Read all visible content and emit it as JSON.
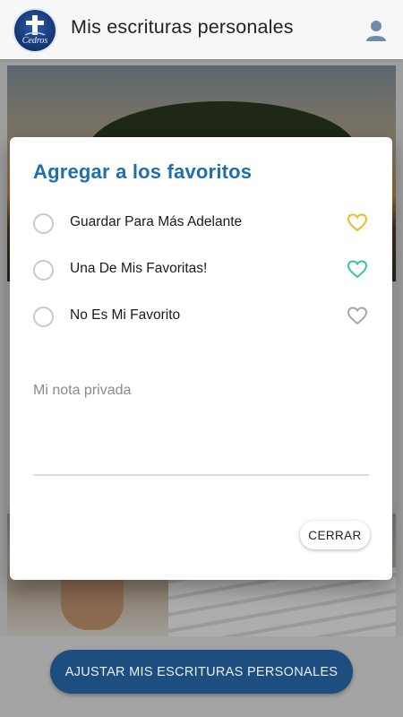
{
  "header": {
    "title": "Mis escrituras personales",
    "logo_text": "Cedros",
    "logo_icon": "cross-logo",
    "user_icon": "user-icon"
  },
  "background": {
    "cta_label": "AJUSTAR MIS ESCRITURAS PERSONALES"
  },
  "dialog": {
    "title": "Agregar a los favoritos",
    "options": [
      {
        "label": "Guardar Para Más Adelante",
        "heart_color": "#f1b824",
        "selected": false
      },
      {
        "label": "Una De Mis Favoritas!",
        "heart_color": "#3cc29a",
        "selected": false
      },
      {
        "label": "No Es Mi Favorito",
        "heart_color": "#a6a6a6",
        "selected": false
      }
    ],
    "note_placeholder": "Mi nota privada",
    "close_label": "CERRAR"
  },
  "colors": {
    "title_blue": "#1f6fae",
    "cta_blue": "#1d4e7f"
  }
}
